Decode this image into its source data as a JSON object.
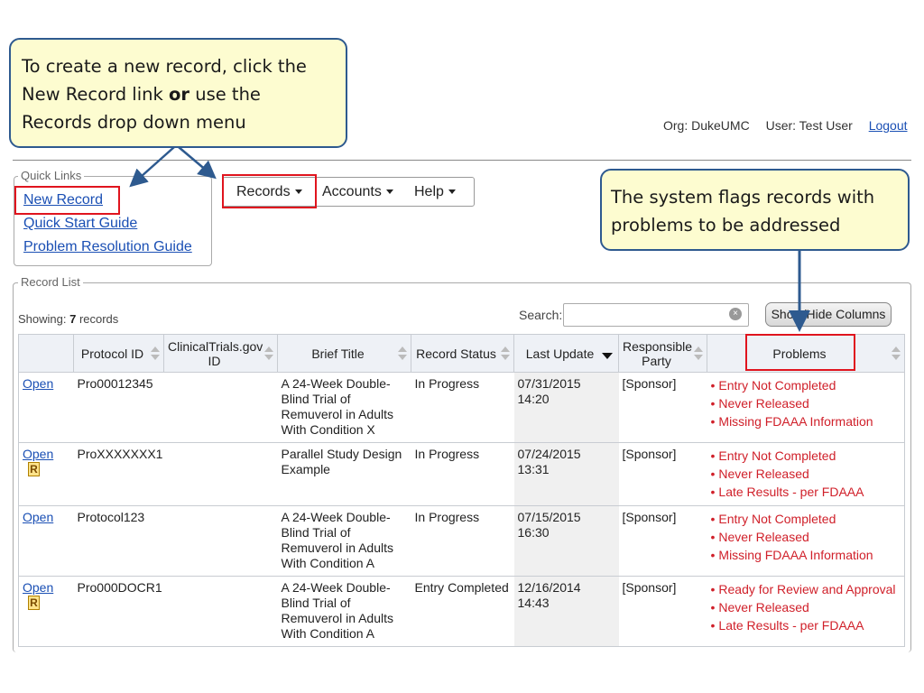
{
  "callouts": {
    "new_record": {
      "line1": "To create a new record, click the",
      "line2_pre": "New Record link ",
      "line2_bold": "or",
      "line2_post": " use the",
      "line3": "Records drop down menu"
    },
    "problems": {
      "line1": "The system flags records with",
      "line2": "problems to be addressed"
    }
  },
  "header": {
    "org": "Org: DukeUMC",
    "user": "User: Test User",
    "logout": "Logout"
  },
  "quick_links": {
    "legend": "Quick Links",
    "items": [
      "New Record",
      "Quick Start Guide",
      "Problem Resolution Guide"
    ]
  },
  "menu": {
    "items": [
      "Records",
      "Accounts",
      "Help"
    ]
  },
  "record_list": {
    "legend": "Record List",
    "showing_label": "Showing: ",
    "showing_count": "7",
    "showing_suffix": " records",
    "search_label": "Search:",
    "search_value": "",
    "show_hide_label": "Show/Hide Columns",
    "columns": [
      "",
      "Protocol ID",
      "ClinicalTrials.gov ID",
      "Brief Title",
      "Record Status",
      "Last Update",
      "Responsible Party",
      "Problems"
    ],
    "rows": [
      {
        "action": "Open",
        "badge": "",
        "protocol_id": "Pro00012345",
        "nct_id": "",
        "title": "A 24-Week Double-Blind Trial of Remuverol in Adults With Condition X",
        "status": "In Progress",
        "updated": "07/31/2015 14:20",
        "party": "[Sponsor]",
        "problems": [
          "Entry Not Completed",
          "Never Released",
          "Missing FDAAA Information"
        ]
      },
      {
        "action": "Open",
        "badge": "R",
        "protocol_id": "ProXXXXXXX1",
        "nct_id": "",
        "title": "Parallel Study Design Example",
        "status": "In Progress",
        "updated": "07/24/2015 13:31",
        "party": "[Sponsor]",
        "problems": [
          "Entry Not Completed",
          "Never Released",
          "Late Results - per FDAAA"
        ]
      },
      {
        "action": "Open",
        "badge": "",
        "protocol_id": "Protocol123",
        "nct_id": "",
        "title": "A 24-Week Double-Blind Trial of Remuverol in Adults With Condition A",
        "status": "In Progress",
        "updated": "07/15/2015 16:30",
        "party": "[Sponsor]",
        "problems": [
          "Entry Not Completed",
          "Never Released",
          "Missing FDAAA Information"
        ]
      },
      {
        "action": "Open",
        "badge": "R",
        "protocol_id": "Pro000DOCR1",
        "nct_id": "",
        "title": "A 24-Week Double-Blind Trial of Remuverol in Adults With Condition A",
        "status": "Entry Completed",
        "updated": "12/16/2014 14:43",
        "party": "[Sponsor]",
        "problems": [
          "Ready for Review and Approval",
          "Never Released",
          "Late Results - per FDAAA"
        ]
      }
    ]
  },
  "colors": {
    "callout_bg": "#fdfcd0",
    "callout_border": "#2e5a8f",
    "highlight": "#e0141e",
    "link": "#1a4fb4",
    "problem_text": "#d0202a"
  }
}
